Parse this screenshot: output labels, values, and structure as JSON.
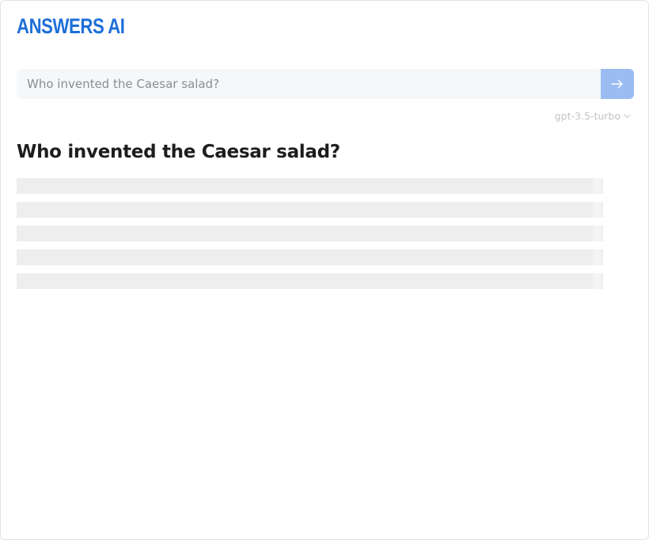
{
  "app": {
    "logo_text": "ANSWERS AI"
  },
  "search": {
    "placeholder": "Who invented the Caesar salad?",
    "value": "",
    "submit_icon": "arrow-right-icon"
  },
  "model_select": {
    "selected": "gpt-3.5-turbo",
    "icon": "chevron-down-icon"
  },
  "answer": {
    "question": "Who invented the Caesar salad?",
    "loading_lines": 5
  },
  "colors": {
    "brand": "#1e6fd9",
    "submit_button": "#9bbcf2",
    "input_background": "#f5f7fa",
    "skeleton": "#eeeeee"
  }
}
